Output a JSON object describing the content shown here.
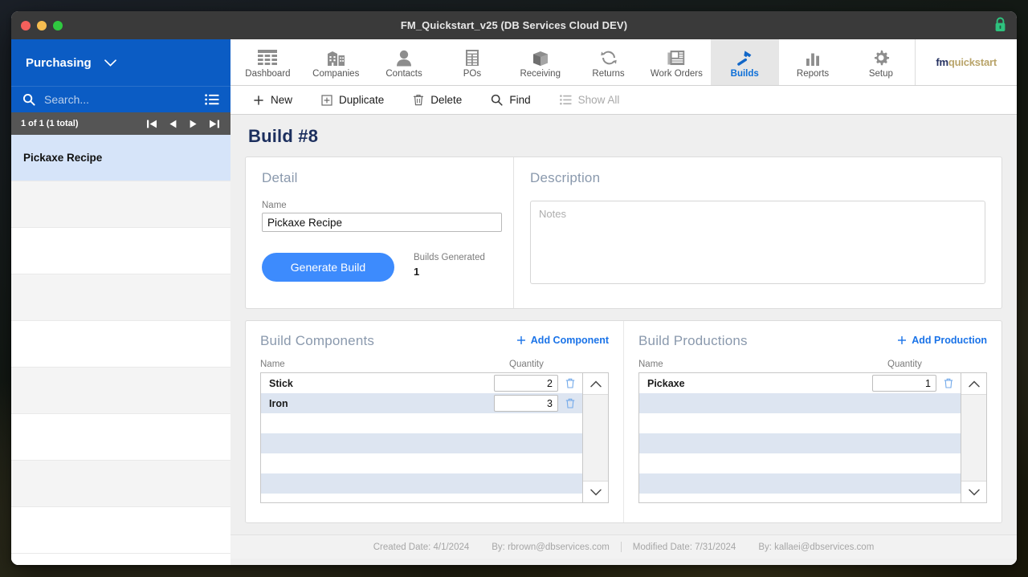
{
  "window": {
    "title": "FM_Quickstart_v25 (DB Services Cloud DEV)",
    "lock_icon": "lock-icon",
    "controls": {
      "close": "close-button",
      "minimize": "minimize-button",
      "zoom": "zoom-button"
    }
  },
  "sidebar": {
    "module_label": "Purchasing",
    "module_chevron": "chevron-down-icon",
    "search": {
      "icon": "search-icon",
      "placeholder": "Search...",
      "value": ""
    },
    "list_view_icon": "list-view-icon",
    "record_count": "1 of 1 (1 total)",
    "nav": [
      {
        "name": "first-record-button",
        "icon": "skip-back-icon"
      },
      {
        "name": "previous-record-button",
        "icon": "triangle-left-icon"
      },
      {
        "name": "next-record-button",
        "icon": "triangle-right-icon"
      },
      {
        "name": "last-record-button",
        "icon": "skip-forward-icon"
      }
    ],
    "records": [
      {
        "label": "Pickaxe Recipe",
        "selected": true
      },
      {
        "label": "",
        "selected": false
      },
      {
        "label": "",
        "selected": false
      },
      {
        "label": "",
        "selected": false
      },
      {
        "label": "",
        "selected": false
      },
      {
        "label": "",
        "selected": false
      },
      {
        "label": "",
        "selected": false
      },
      {
        "label": "",
        "selected": false
      },
      {
        "label": "",
        "selected": false
      }
    ]
  },
  "topnav": {
    "items": [
      {
        "label": "Dashboard",
        "icon": "grid-table-icon",
        "active": false
      },
      {
        "label": "Companies",
        "icon": "buildings-icon",
        "active": false
      },
      {
        "label": "Contacts",
        "icon": "person-icon",
        "active": false
      },
      {
        "label": "POs",
        "icon": "document-table-icon",
        "active": false
      },
      {
        "label": "Receiving",
        "icon": "box-icon",
        "active": false
      },
      {
        "label": "Returns",
        "icon": "refresh-arrows-icon",
        "active": false
      },
      {
        "label": "Work Orders",
        "icon": "newspaper-icon",
        "active": false
      },
      {
        "label": "Builds",
        "icon": "hammer-icon",
        "active": true
      },
      {
        "label": "Reports",
        "icon": "bar-chart-icon",
        "active": false
      },
      {
        "label": "Setup",
        "icon": "gear-icon",
        "active": false
      }
    ],
    "logo": {
      "prefix": "fm",
      "suffix": "quickstart"
    }
  },
  "actionbar": {
    "items": [
      {
        "label": "New",
        "icon": "plus-icon",
        "disabled": false
      },
      {
        "label": "Duplicate",
        "icon": "duplicate-icon",
        "disabled": false
      },
      {
        "label": "Delete",
        "icon": "trash-icon",
        "disabled": false
      },
      {
        "label": "Find",
        "icon": "search-icon",
        "disabled": false
      },
      {
        "label": "Show All",
        "icon": "list-icon",
        "disabled": true
      }
    ]
  },
  "page": {
    "title": "Build #8"
  },
  "detail": {
    "heading": "Detail",
    "name_label": "Name",
    "name_value": "Pickaxe Recipe",
    "generate_button": "Generate Build",
    "builds_generated_label": "Builds Generated",
    "builds_generated_value": "1"
  },
  "description": {
    "heading": "Description",
    "notes_placeholder": "Notes",
    "notes_value": ""
  },
  "components": {
    "heading": "Build Components",
    "add_label": "Add Component",
    "add_icon": "plus-icon",
    "columns": {
      "name": "Name",
      "quantity": "Quantity"
    },
    "rows": [
      {
        "name": "Stick",
        "quantity": "2",
        "delete_icon": "trash-icon"
      },
      {
        "name": "Iron",
        "quantity": "3",
        "delete_icon": "trash-icon"
      }
    ],
    "empty_rows": 4,
    "scroll_up_icon": "chevron-up-icon",
    "scroll_down_icon": "chevron-down-icon"
  },
  "productions": {
    "heading": "Build Productions",
    "add_label": "Add Production",
    "add_icon": "plus-icon",
    "columns": {
      "name": "Name",
      "quantity": "Quantity"
    },
    "rows": [
      {
        "name": "Pickaxe",
        "quantity": "1",
        "delete_icon": "trash-icon"
      }
    ],
    "empty_rows": 5,
    "scroll_up_icon": "chevron-up-icon",
    "scroll_down_icon": "chevron-down-icon"
  },
  "footer": {
    "created_date": "Created Date: 4/1/2024",
    "created_by": "By: rbrown@dbservices.com",
    "modified_date": "Modified Date: 7/31/2024",
    "modified_by": "By: kallaei@dbservices.com"
  },
  "colors": {
    "sidebar_blue": "#0b5cc4",
    "accent_blue": "#3d8bfd",
    "link_blue": "#1a73e8",
    "title_navy": "#1c2f5e",
    "row_stripe": "#dde5f1",
    "selected_row": "#d6e4f9"
  }
}
